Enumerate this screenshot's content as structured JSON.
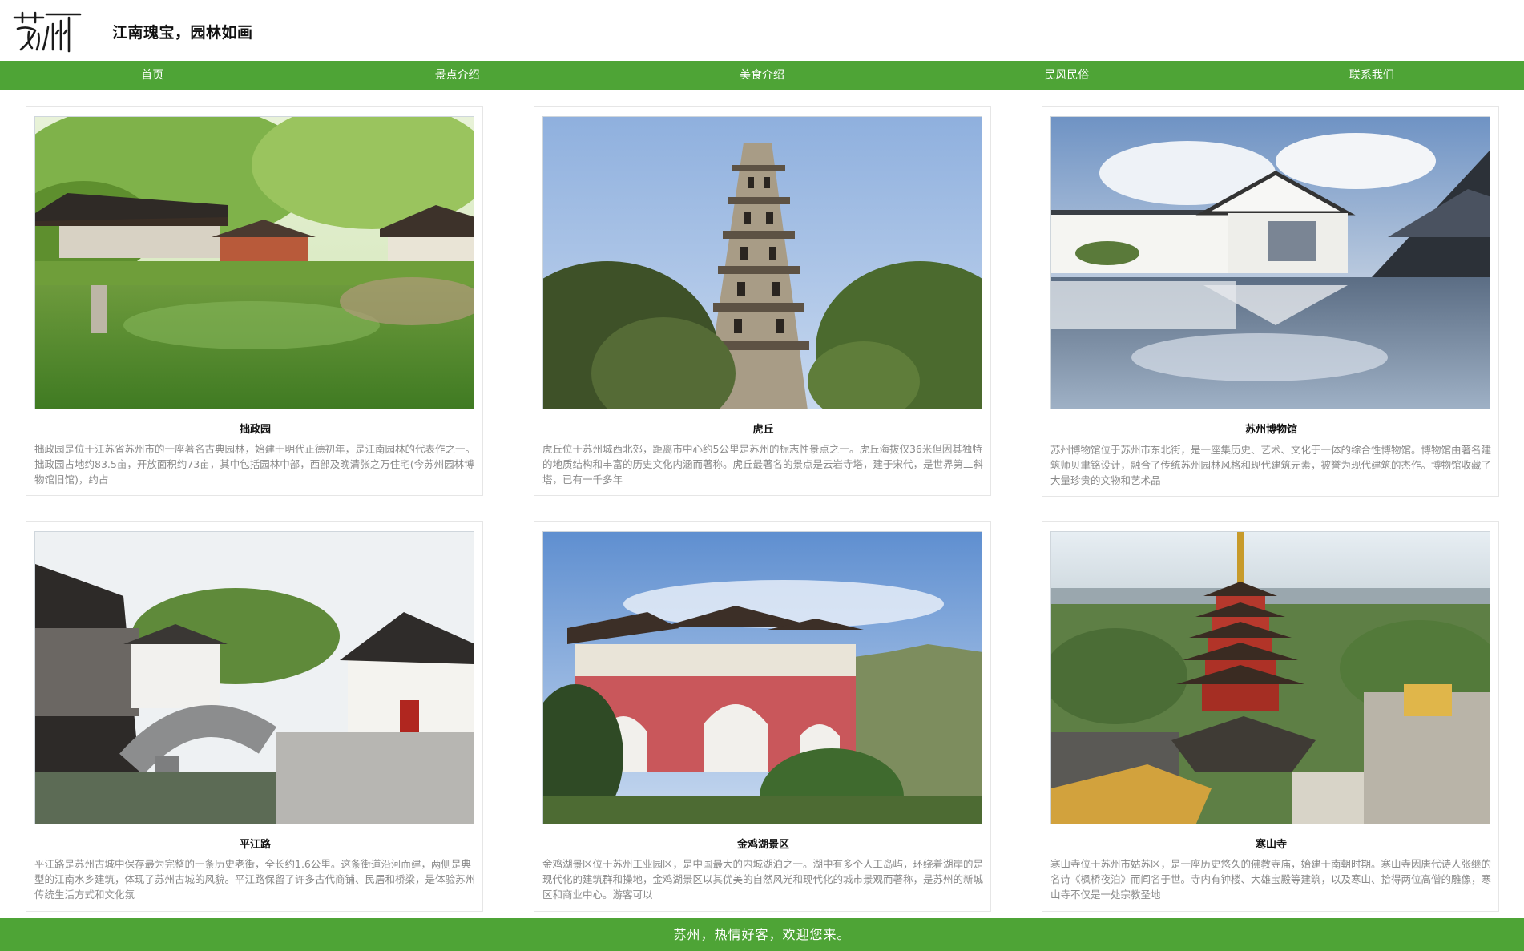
{
  "header": {
    "logo_alt": "苏州",
    "slogan": "江南瑰宝，园林如画"
  },
  "nav": {
    "items": [
      {
        "label": "首页"
      },
      {
        "label": "景点介绍"
      },
      {
        "label": "美食介绍"
      },
      {
        "label": "民风民俗"
      },
      {
        "label": "联系我们"
      }
    ]
  },
  "cards": [
    {
      "title": "拙政园",
      "description": "拙政园是位于江苏省苏州市的一座著名古典园林，始建于明代正德初年，是江南园林的代表作之一。拙政园占地约83.5亩，开放面积约73亩，其中包括园林中部，西部及晚清张之万住宅(今苏州园林博物馆旧馆)，约占",
      "image": "garden-pavilion-pond-photo"
    },
    {
      "title": "虎丘",
      "description": "虎丘位于苏州城西北郊，距离市中心约5公里是苏州的标志性景点之一。虎丘海拔仅36米但因其独特的地质结构和丰富的历史文化内涵而著称。虎丘最著名的景点是云岩寺塔，建于宋代，是世界第二斜塔，已有一千多年",
      "image": "leaning-pagoda-photo"
    },
    {
      "title": "苏州博物馆",
      "description": "苏州博物馆位于苏州市东北街，是一座集历史、艺术、文化于一体的综合性博物馆。博物馆由著名建筑师贝聿铭设计，融合了传统苏州园林风格和现代建筑元素，被誉为现代建筑的杰作。博物馆收藏了大量珍贵的文物和艺术品",
      "image": "museum-reflection-photo"
    },
    {
      "title": "平江路",
      "description": "平江路是苏州古城中保存最为完整的一条历史老街，全长约1.6公里。这条街道沿河而建，两侧是典型的江南水乡建筑，体现了苏州古城的风貌。平江路保留了许多古代商铺、民居和桥梁，是体验苏州传统生活方式和文化氛",
      "image": "canal-street-bridge-photo"
    },
    {
      "title": "金鸡湖景区",
      "description": "金鸡湖景区位于苏州工业园区，是中国最大的内城湖泊之一。湖中有多个人工岛屿，环绕着湖岸的是现代化的建筑群和操地，金鸡湖景区以其优美的自然风光和现代化的城市景观而著称，是苏州的新城区和商业中心。游客可以",
      "image": "red-gate-building-photo"
    },
    {
      "title": "寒山寺",
      "description": "寒山寺位于苏州市姑苏区，是一座历史悠久的佛教寺庙，始建于南朝时期。寒山寺因唐代诗人张继的名诗《枫桥夜泊》而闻名于世。寺内有钟楼、大雄宝殿等建筑，以及寒山、拾得两位高僧的雕像，寒山寺不仅是一处宗教圣地",
      "image": "temple-pagoda-aerial-photo"
    }
  ],
  "footer": {
    "text": "苏州，热情好客，欢迎您来。"
  },
  "colors": {
    "brand_green": "#4ea436",
    "description_gray": "#8a8a8a"
  }
}
